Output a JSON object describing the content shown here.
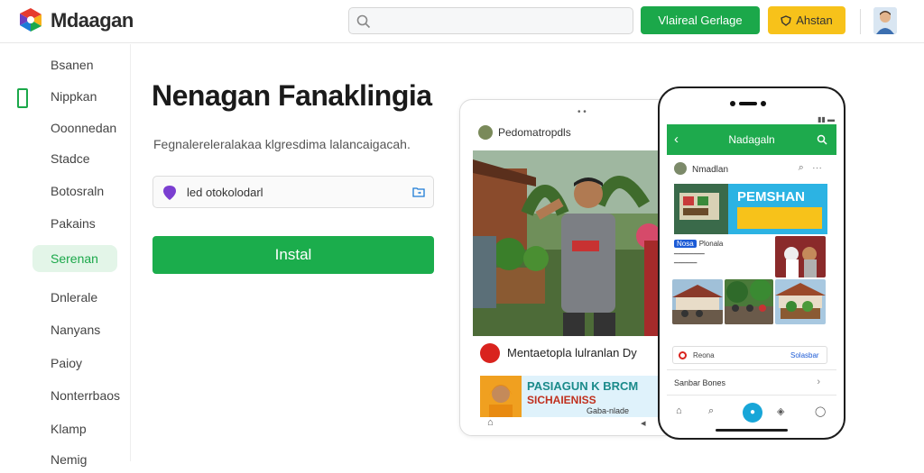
{
  "header": {
    "brand": "Mdaagan",
    "search": {
      "placeholder": "",
      "value": ""
    },
    "primary_button": "Vlaireal Gerlage",
    "secondary_button": "Ahstan"
  },
  "sidebar": {
    "items": [
      {
        "label": "Bsanen"
      },
      {
        "label": "Nippkan"
      },
      {
        "label": "Ooonnedan"
      },
      {
        "label": "Stadce"
      },
      {
        "label": "Botosraln"
      },
      {
        "label": "Pakains"
      },
      {
        "label": "Serenan"
      },
      {
        "label": "Dnlerale"
      },
      {
        "label": "Nanyans"
      },
      {
        "label": "Paioy"
      },
      {
        "label": "Nonterrbaos"
      },
      {
        "label": "Klamp"
      },
      {
        "label": "Nemig"
      }
    ]
  },
  "main": {
    "title": "Nenagan Fanaklingia",
    "subtitle": "Fegnalereleralakaa klgresdima lalancaigacah.",
    "input_value": "led otokolodarl",
    "install_label": "Instal"
  },
  "tablet": {
    "header_user": "Pedomatropdls",
    "card_title": "Mentaetopla lulranlan Dy",
    "ad_line1": "PASIAGUN K BRCM",
    "ad_line2": "SICHAIENISS",
    "ad_line3": "Gaba-nlade"
  },
  "phone": {
    "appbar_title": "Nadagaln",
    "user": "Nmadlan",
    "banner_title": "PEMSHAN",
    "tag": "Nosa",
    "tag_text": "Plonala",
    "row_left": "Reona",
    "row_right": "Solasbar",
    "list_item": "Sanbar Bones"
  },
  "colors": {
    "accent": "#1ba84a",
    "secondary": "#f7c21a",
    "banner": "#2cb3e3"
  }
}
